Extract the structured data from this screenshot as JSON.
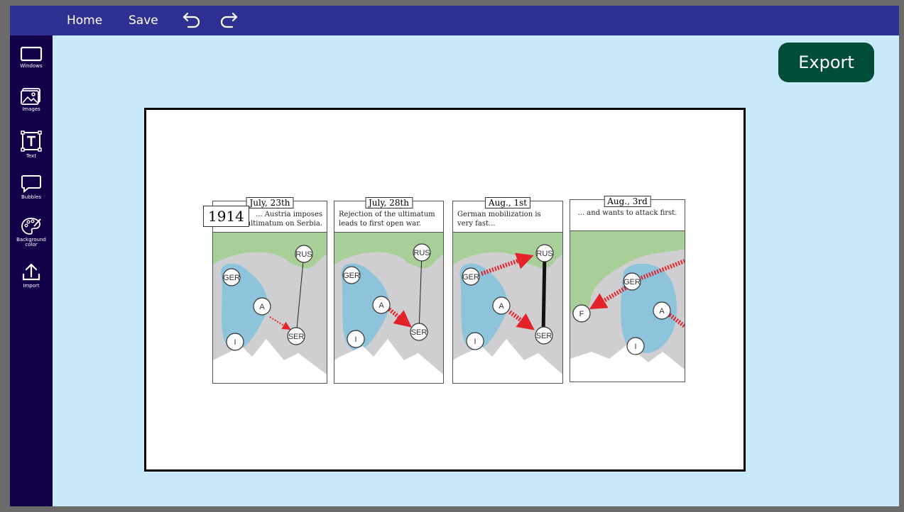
{
  "toolbar": {
    "home_label": "Home",
    "save_label": "Save",
    "undo_icon": "undo-icon",
    "redo_icon": "redo-icon"
  },
  "sidebar": {
    "items": [
      {
        "label": "Windows",
        "icon": "window-icon"
      },
      {
        "label": "Images",
        "icon": "image-icon"
      },
      {
        "label": "Text",
        "icon": "text-icon"
      },
      {
        "label": "Bubbles",
        "icon": "speech-bubble-icon"
      },
      {
        "label": "Background color",
        "icon": "palette-icon"
      },
      {
        "label": "Import",
        "icon": "upload-icon"
      }
    ]
  },
  "export_label": "Export",
  "comic": {
    "year": "1914",
    "panels": [
      {
        "date": "July, 23th",
        "caption": "... Austria imposes ultimatum on Serbia.",
        "nodes": [
          "GER",
          "A",
          "I",
          "RUS",
          "SER"
        ]
      },
      {
        "date": "July, 28th",
        "caption": "Rejection of the ultimatum leads to first open war.",
        "nodes": [
          "GER",
          "A",
          "I",
          "RUS",
          "SER"
        ]
      },
      {
        "date": "Aug., 1st",
        "caption": "German mobilization is very fast...",
        "nodes": [
          "GER",
          "A",
          "I",
          "RUS",
          "SER"
        ]
      },
      {
        "date": "Aug., 3rd",
        "caption": "... and wants to attack first.",
        "nodes": [
          "GER",
          "A",
          "I",
          "F"
        ]
      }
    ]
  },
  "colors": {
    "topbar": "#2e3192",
    "sidebar": "#120048",
    "workspace": "#c9eaf9",
    "export": "#004d3a",
    "alliance_blue": "#8ec3dc",
    "land_gray": "#cfcfd1",
    "forest_green": "#a8cf98",
    "attack_red": "#e4222a"
  }
}
